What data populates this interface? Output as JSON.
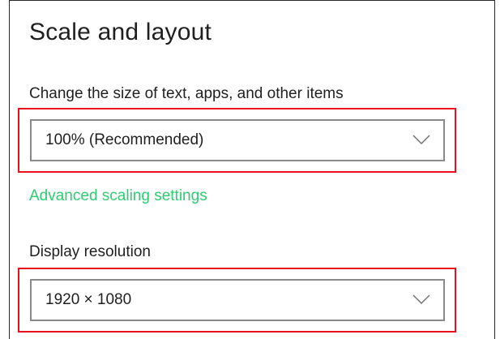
{
  "section": {
    "title": "Scale and layout",
    "scale_label": "Change the size of text, apps, and other items",
    "scale_dropdown": {
      "selected": "100% (Recommended)",
      "icon": "chevron-down-icon"
    },
    "advanced_link": "Advanced scaling settings",
    "resolution_label": "Display resolution",
    "resolution_dropdown": {
      "selected": "1920 × 1080",
      "icon": "chevron-down-icon"
    }
  },
  "colors": {
    "link": "#2ecc71",
    "highlight": "#e8101a",
    "dropdown_border": "#8a8a8a"
  }
}
